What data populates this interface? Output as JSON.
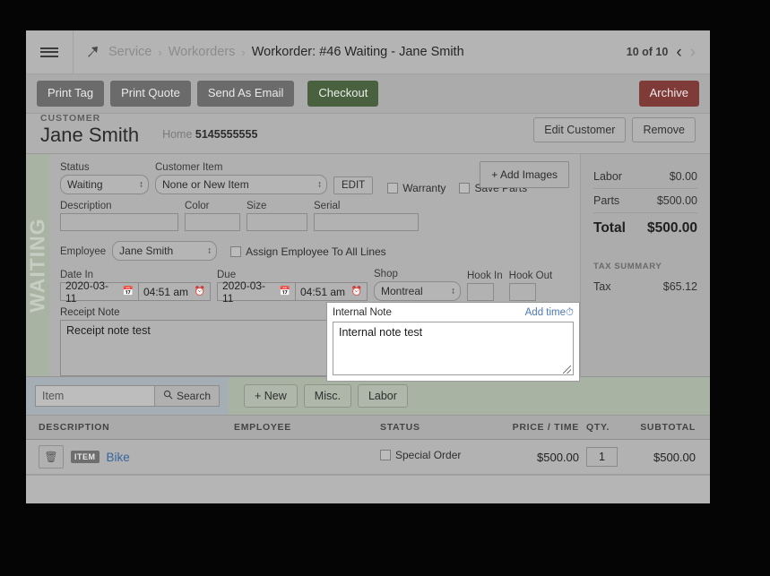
{
  "topbar": {
    "menu_icon": "hamburger-icon",
    "breadcrumb_icon": "wrench-icon",
    "crumb1": "Service",
    "sep1": "›",
    "crumb2": "Workorders",
    "sep2": "›",
    "current": "Workorder: #46 Waiting - Jane Smith",
    "pager_count": "10 of 10",
    "prev_icon": "‹",
    "next_icon": "›"
  },
  "actions": {
    "print_tag": "Print Tag",
    "print_quote": "Print Quote",
    "send_as_email": "Send As Email",
    "checkout": "Checkout",
    "archive": "Archive",
    "checkout_color": "#4a6140",
    "archive_color": "#7e3b38"
  },
  "customer": {
    "label": "CUSTOMER",
    "name": "Jane Smith",
    "phone_label": "Home",
    "phone_value": "5145555555",
    "edit_button": "Edit Customer",
    "remove_button": "Remove"
  },
  "detail": {
    "status_strip_text": "WAITING",
    "status_label": "Status",
    "status_value": "Waiting",
    "customer_item_label": "Customer Item",
    "customer_item_value": "None or New Item",
    "edit_button": "EDIT",
    "warranty_label": "Warranty",
    "save_parts_label": "Save Parts",
    "add_images": "+ Add Images",
    "description_label": "Description",
    "description_value": "",
    "color_label": "Color",
    "color_value": "",
    "size_label": "Size",
    "size_value": "",
    "serial_label": "Serial",
    "serial_value": "",
    "employee_label": "Employee",
    "employee_value": "Jane Smith",
    "assign_all_label": "Assign Employee To All Lines",
    "date_in_label": "Date In",
    "date_in_value": "2020-03-11",
    "time_in_value": "04:51 am",
    "due_label": "Due",
    "due_date_value": "2020-03-11",
    "due_time_value": "04:51 am",
    "shop_label": "Shop",
    "shop_value": "Montreal",
    "hook_in_label": "Hook In",
    "hook_in_value": "",
    "hook_out_label": "Hook Out",
    "hook_out_value": "",
    "receipt_note_label": "Receipt Note",
    "receipt_note_value": "Receipt note test",
    "internal_note_label": "Internal Note",
    "internal_note_value": "Internal note test",
    "add_time_label": "Add time",
    "add_time_icon": "clock-icon"
  },
  "totals": {
    "labor_label": "Labor",
    "labor_value": "$0.00",
    "parts_label": "Parts",
    "parts_value": "$500.00",
    "total_label": "Total",
    "total_value": "$500.00",
    "tax_summary_label": "TAX SUMMARY",
    "tax_label": "Tax",
    "tax_value": "$65.12"
  },
  "items_toolbar": {
    "search_placeholder": "Item",
    "search_value": "",
    "search_button": "Search",
    "search_icon": "magnifier-icon",
    "new_button": "+ New",
    "misc_button": "Misc.",
    "labor_button": "Labor"
  },
  "table": {
    "headers": {
      "description": "DESCRIPTION",
      "employee": "EMPLOYEE",
      "status": "STATUS",
      "price": "PRICE / TIME",
      "qty": "QTY.",
      "subtotal": "SUBTOTAL"
    },
    "rows": [
      {
        "delete_icon": "trash-icon",
        "tag": "ITEM",
        "description": "Bike",
        "employee": "",
        "status": "Special Order",
        "price": "$500.00",
        "qty": "1",
        "subtotal": "$500.00"
      }
    ]
  }
}
